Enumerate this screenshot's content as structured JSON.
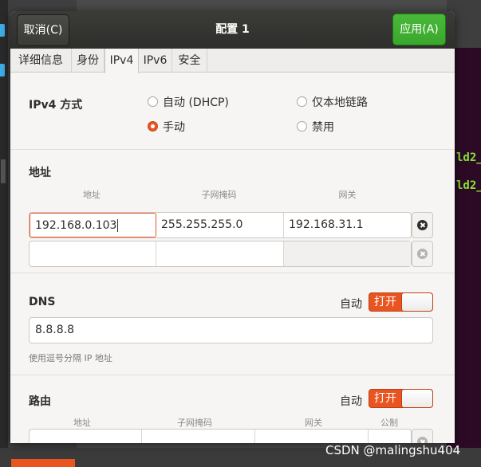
{
  "dialog": {
    "title": "配置 1",
    "cancel_label": "取消(C)",
    "apply_label": "应用(A)"
  },
  "tabs": [
    {
      "label": "详细信息",
      "active": false
    },
    {
      "label": "身份",
      "active": false
    },
    {
      "label": "IPv4",
      "active": true
    },
    {
      "label": "IPv6",
      "active": false
    },
    {
      "label": "安全",
      "active": false
    }
  ],
  "ipv4_method": {
    "label": "IPv4 方式",
    "options": [
      {
        "label": "自动 (DHCP)",
        "checked": false
      },
      {
        "label": "仅本地链路",
        "checked": false
      },
      {
        "label": "手动",
        "checked": true
      },
      {
        "label": "禁用",
        "checked": false
      }
    ]
  },
  "addresses": {
    "label": "地址",
    "headers": [
      "地址",
      "子网掩码",
      "网关"
    ],
    "rows": [
      {
        "address": "192.168.0.103",
        "netmask": "255.255.255.0",
        "gateway": "192.168.31.1"
      },
      {
        "address": "",
        "netmask": "",
        "gateway": ""
      }
    ]
  },
  "dns": {
    "label": "DNS",
    "auto_label": "自动",
    "switch_label": "打开",
    "switch_on": true,
    "value": "8.8.8.8",
    "hint": "使用逗号分隔 IP 地址"
  },
  "routes": {
    "label": "路由",
    "auto_label": "自动",
    "switch_label": "打开",
    "switch_on": true,
    "headers": [
      "地址",
      "子网掩码",
      "网关",
      "公制"
    ]
  },
  "background": {
    "terminal_lines": [
      "ld2_",
      "ld2_"
    ],
    "watermark": "CSDN @malingshu404"
  },
  "colors": {
    "accent": "#e95420",
    "apply_green": "#3aa72c",
    "headerbar": "#2e2e2c"
  }
}
